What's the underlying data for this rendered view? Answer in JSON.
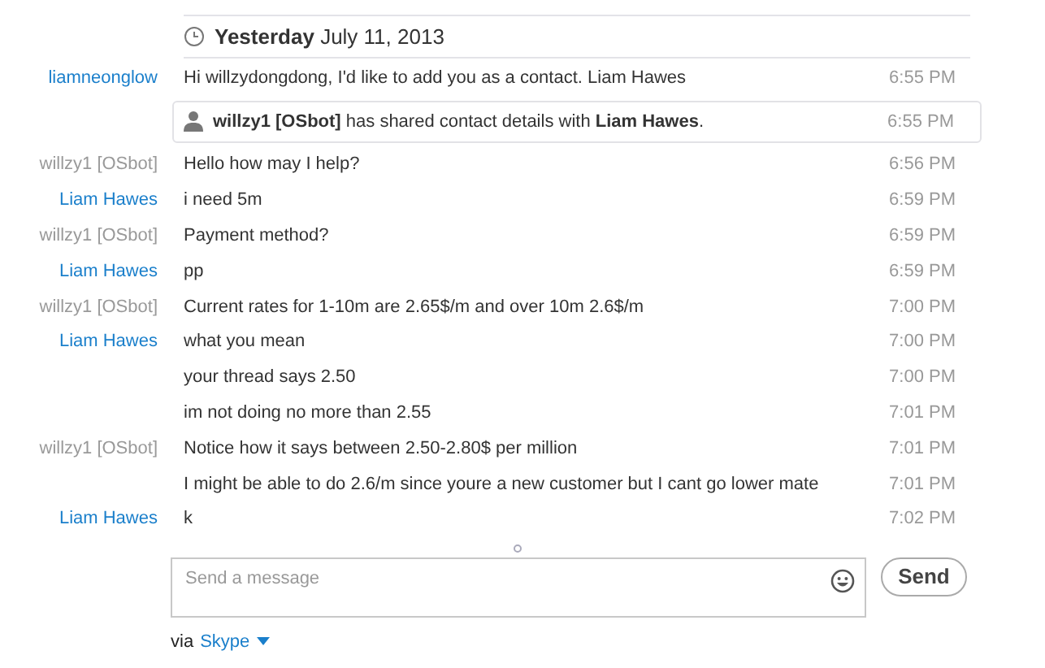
{
  "date_header": {
    "day": "Yesterday",
    "date": "July 11, 2013"
  },
  "messages": [
    {
      "kind": "message",
      "sender": "liamneonglow",
      "color": "#1a7fcb",
      "text": "Hi willzydongdong, I'd like to add you as a contact. Liam Hawes",
      "time": "6:55 PM"
    },
    {
      "kind": "notice",
      "text": "**willzy1 [OSbot]** has shared contact details with **Liam Hawes**.",
      "time": "6:55 PM"
    },
    {
      "kind": "message",
      "sender": "willzy1 [OSbot]",
      "color": "#999999",
      "text": "Hello how may I help?",
      "time": "6:56 PM"
    },
    {
      "kind": "message",
      "sender": "Liam Hawes",
      "color": "#1a7fcb",
      "text": "i need 5m",
      "time": "6:59 PM"
    },
    {
      "kind": "message",
      "sender": "willzy1 [OSbot]",
      "color": "#999999",
      "text": "Payment method?",
      "time": "6:59 PM"
    },
    {
      "kind": "message",
      "sender": "Liam Hawes",
      "color": "#1a7fcb",
      "text": "pp",
      "time": "6:59 PM"
    },
    {
      "kind": "message",
      "sender": "willzy1 [OSbot]",
      "color": "#999999",
      "text": "Current rates for 1-10m are 2.65$/m and over 10m 2.6$/m",
      "time": "7:00 PM"
    },
    {
      "kind": "message",
      "sender": "Liam Hawes",
      "color": "#1a7fcb",
      "text": "what you mean",
      "time": "7:00 PM"
    },
    {
      "kind": "message",
      "text": "your thread says 2.50",
      "time": "7:00 PM"
    },
    {
      "kind": "message",
      "text": "im not doing no more than 2.55",
      "time": "7:01 PM"
    },
    {
      "kind": "message",
      "sender": "willzy1 [OSbot]",
      "color": "#999999",
      "text": "Notice how it says between 2.50-2.80$ per million",
      "time": "7:01 PM"
    },
    {
      "kind": "message",
      "text": "I might be able to do 2.6/m since youre a new customer but I cant go lower mate",
      "time": "7:01 PM"
    },
    {
      "kind": "message",
      "sender": "Liam Hawes",
      "color": "#1a7fcb",
      "text": "k",
      "time": "7:02 PM"
    }
  ],
  "composer": {
    "placeholder": "Send a message",
    "send": "Send"
  },
  "via": {
    "prefix": "via",
    "service": "Skype"
  }
}
